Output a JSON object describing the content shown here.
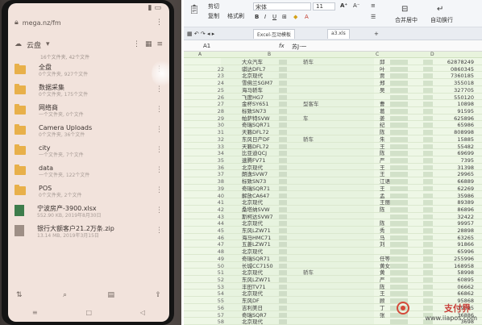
{
  "phone": {
    "status_time": "",
    "url": "mega.nz/fm",
    "drive_title": "云盘",
    "summary": "16个文件夹, 42个文件",
    "files": [
      {
        "name": "全盘",
        "meta": "0个文件夹, 927个文件",
        "kind": "folder"
      },
      {
        "name": "数据采集",
        "meta": "0个文件夹, 175个文件",
        "kind": "folder"
      },
      {
        "name": "网络商",
        "meta": "一个文件夹, 0个文件",
        "kind": "folder"
      },
      {
        "name": "Camera Uploads",
        "meta": "0个文件夹, 36个文件",
        "kind": "folder"
      },
      {
        "name": "city",
        "meta": "一个文件夹, 7个文件",
        "kind": "folder"
      },
      {
        "name": "data",
        "meta": "一个文件夹, 122个文件",
        "kind": "folder"
      },
      {
        "name": "POS",
        "meta": "0个文件夹, 2个文件",
        "kind": "folder"
      },
      {
        "name": "宁波房产-3900.xlsx",
        "meta": "552.90 KB, 2019年8月30日",
        "kind": "xlsx"
      },
      {
        "name": "银行大额客户21.2万条.zip",
        "meta": "13.14 MB, 2019年3月15日",
        "kind": "zip"
      }
    ]
  },
  "sheet": {
    "ribbon": {
      "cut": "剪切",
      "copy": "复制",
      "format_painter": "格式刷",
      "font": "宋体",
      "size": "11",
      "merge_center": "合并居中",
      "wrap": "自动换行"
    },
    "tabs": [
      "Excel-互动模板",
      "a3.xls"
    ],
    "formula_bar": {
      "cell": "A1",
      "fx": "fx",
      "value": "苏J·一"
    },
    "columns": [
      "A",
      "B",
      "C",
      "D"
    ],
    "rows": [
      {
        "n": "",
        "model": "大众汽车",
        "note": "轿车",
        "name": "邱",
        "phone": "62878249"
      },
      {
        "n": "22",
        "model": "骐达DFL7",
        "note": "",
        "name": "叶",
        "phone": "0860345"
      },
      {
        "n": "23",
        "model": "北京现代",
        "note": "",
        "name": "贾",
        "phone": "7360185"
      },
      {
        "n": "24",
        "model": "雪佛兰SGM7",
        "note": "",
        "name": "郑",
        "phone": "355018"
      },
      {
        "n": "25",
        "model": "海马轿车",
        "note": "",
        "name": "吴",
        "phone": "327705"
      },
      {
        "n": "26",
        "model": "飞度HG7",
        "note": "",
        "name": "",
        "phone": "550120"
      },
      {
        "n": "27",
        "model": "金杯SY651",
        "note": "型客车",
        "name": "曹",
        "phone": "10898"
      },
      {
        "n": "28",
        "model": "标致SN73",
        "note": "",
        "name": "葛",
        "phone": "91595"
      },
      {
        "n": "29",
        "model": "帕萨特SVW",
        "note": "车",
        "name": "姜",
        "phone": "625896"
      },
      {
        "n": "30",
        "model": "奇瑞SQR71",
        "note": "",
        "name": "纪",
        "phone": "65986"
      },
      {
        "n": "31",
        "model": "天籁DFL72",
        "note": "",
        "name": "陈",
        "phone": "808998"
      },
      {
        "n": "32",
        "model": "东风日产DF",
        "note": "轿车",
        "name": "朱",
        "phone": "15885"
      },
      {
        "n": "33",
        "model": "天籁DFL72",
        "note": "",
        "name": "王",
        "phone": "55482"
      },
      {
        "n": "34",
        "model": "比亚迪QCJ",
        "note": "",
        "name": "陈",
        "phone": "69699"
      },
      {
        "n": "35",
        "model": "速腾FV71",
        "note": "",
        "name": "严",
        "phone": "7395"
      },
      {
        "n": "36",
        "model": "北京现代",
        "note": "",
        "name": "王",
        "phone": "31398"
      },
      {
        "n": "37",
        "model": "朗逸SVW7",
        "note": "",
        "name": "王",
        "phone": "29965"
      },
      {
        "n": "38",
        "model": "标致SN73",
        "note": "",
        "name": "江语",
        "phone": "66889"
      },
      {
        "n": "39",
        "model": "奇瑞SQR71",
        "note": "",
        "name": "王",
        "phone": "62269"
      },
      {
        "n": "40",
        "model": "解放CA647",
        "note": "",
        "name": "孟",
        "phone": "35986"
      },
      {
        "n": "41",
        "model": "北京现代",
        "note": "",
        "name": "王丽",
        "phone": "89389"
      },
      {
        "n": "42",
        "model": "桑塔纳SVW",
        "note": "",
        "name": "陈",
        "phone": "86896"
      },
      {
        "n": "43",
        "model": "斯柯达SVW7",
        "note": "",
        "name": "",
        "phone": "32422"
      },
      {
        "n": "44",
        "model": "北京现代",
        "note": "",
        "name": "陈",
        "phone": "99957"
      },
      {
        "n": "45",
        "model": "东风LZW71",
        "note": "",
        "name": "秀",
        "phone": "28898"
      },
      {
        "n": "46",
        "model": "海马HMC71",
        "note": "",
        "name": "马",
        "phone": "63265"
      },
      {
        "n": "47",
        "model": "五菱LZW71",
        "note": "",
        "name": "刘",
        "phone": "91866"
      },
      {
        "n": "48",
        "model": "北京现代",
        "note": "",
        "name": "",
        "phone": "65996"
      },
      {
        "n": "49",
        "model": "奇瑞SQR71",
        "note": "",
        "name": "任等",
        "phone": "255996"
      },
      {
        "n": "50",
        "model": "长城CC7150",
        "note": "",
        "name": "黄女",
        "phone": "168958"
      },
      {
        "n": "51",
        "model": "北京现代",
        "note": "轿车",
        "name": "黄",
        "phone": "58998"
      },
      {
        "n": "52",
        "model": "东风LZW71",
        "note": "",
        "name": "严",
        "phone": "60895"
      },
      {
        "n": "53",
        "model": "丰田TV71",
        "note": "",
        "name": "陈",
        "phone": "06662"
      },
      {
        "n": "54",
        "model": "北京现代",
        "note": "",
        "name": "王",
        "phone": "66862"
      },
      {
        "n": "55",
        "model": "东风DF",
        "note": "",
        "name": "顾",
        "phone": "95868"
      },
      {
        "n": "56",
        "model": "吉利美日",
        "note": "",
        "name": "丁",
        "phone": "19595"
      },
      {
        "n": "57",
        "model": "奇瑞SQR7",
        "note": "",
        "name": "张",
        "phone": "36886"
      },
      {
        "n": "58",
        "model": "北京现代",
        "note": "",
        "name": "",
        "phone": "3698"
      }
    ]
  },
  "watermark": {
    "name": "支付界",
    "url": "www.iiapos.com"
  }
}
